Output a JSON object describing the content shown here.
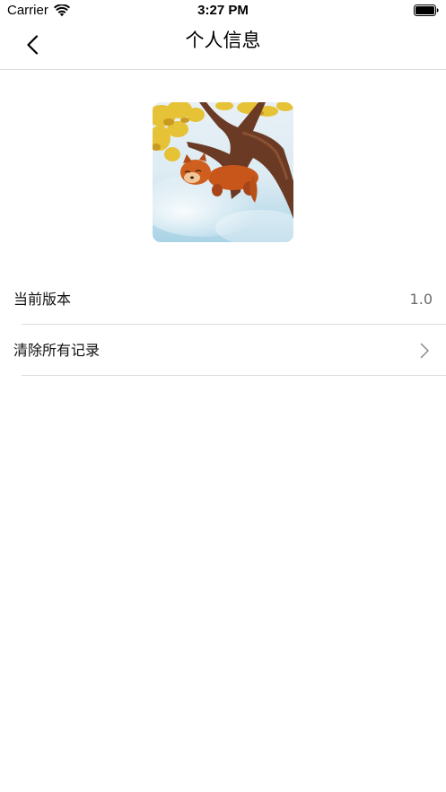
{
  "status_bar": {
    "carrier": "Carrier",
    "time": "3:27 PM",
    "icons": [
      "wifi-icon",
      "battery-icon"
    ]
  },
  "nav": {
    "title": "个人信息",
    "back_icon": "chevron-left-icon"
  },
  "avatar": {
    "description_icon": "avatar-image"
  },
  "settings": {
    "version": {
      "label": "当前版本",
      "value": "1.0"
    },
    "clear_records": {
      "label": "清除所有记录",
      "icon": "chevron-right-icon"
    }
  },
  "colors": {
    "background": "#ffffff",
    "divider": "#dcdcdc",
    "secondary_text": "#6b6b6b"
  }
}
